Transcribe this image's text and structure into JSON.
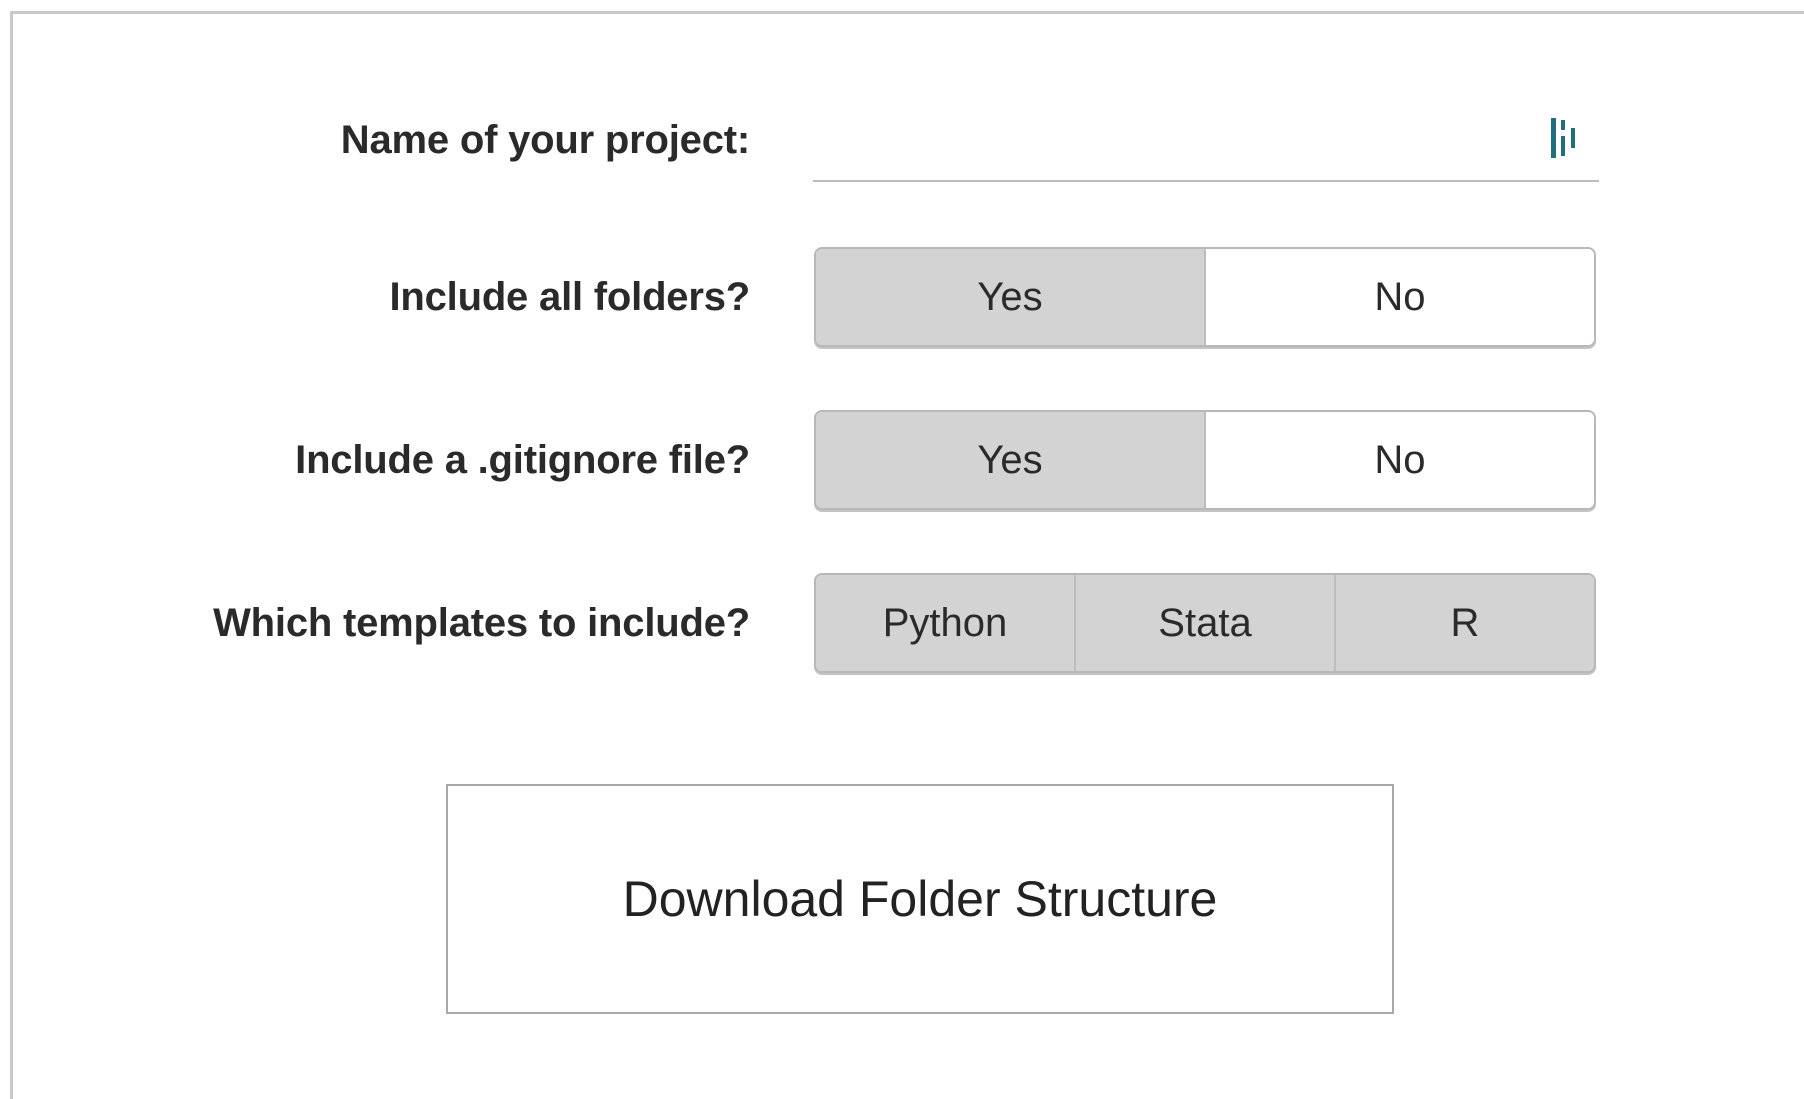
{
  "form": {
    "project_name": {
      "label": "Name of your project:",
      "value": "",
      "placeholder": ""
    },
    "include_all_folders": {
      "label": "Include all folders?",
      "options": [
        "Yes",
        "No"
      ],
      "selected": "Yes"
    },
    "include_gitignore": {
      "label": "Include a .gitignore file?",
      "options": [
        "Yes",
        "No"
      ],
      "selected": "Yes"
    },
    "templates": {
      "label": "Which templates to include?",
      "options": [
        "Python",
        "Stata",
        "R"
      ],
      "selected": [
        "Python",
        "Stata",
        "R"
      ]
    },
    "download_label": "Download Folder Structure"
  },
  "colors": {
    "selected_bg": "#d3d3d3",
    "unselected_bg": "#ffffff",
    "border": "#b8b8b8",
    "password_manager_icon": "#1f6f7f"
  },
  "icons": {
    "input_trailing": "password-manager-icon"
  }
}
